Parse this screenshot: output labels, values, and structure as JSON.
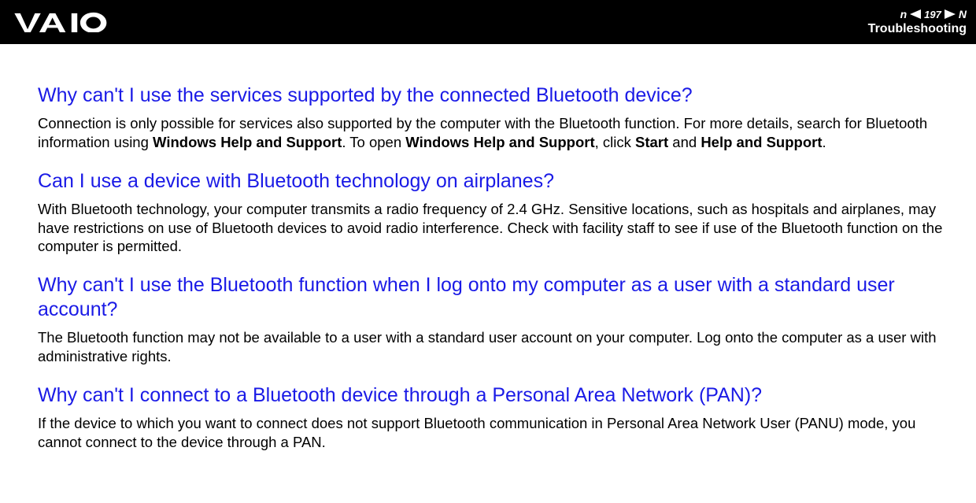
{
  "header": {
    "page_number": "197",
    "n_left": "n",
    "n_right": "N",
    "section": "Troubleshooting"
  },
  "sections": [
    {
      "question": "Why can't I use the services supported by the connected Bluetooth device?",
      "answer_parts": [
        {
          "text": "Connection is only possible for services also supported by the computer with the Bluetooth function. For more details, search for Bluetooth information using ",
          "bold": false
        },
        {
          "text": "Windows Help and Support",
          "bold": true
        },
        {
          "text": ". To open ",
          "bold": false
        },
        {
          "text": "Windows Help and Support",
          "bold": true
        },
        {
          "text": ", click ",
          "bold": false
        },
        {
          "text": "Start",
          "bold": true
        },
        {
          "text": " and ",
          "bold": false
        },
        {
          "text": "Help and Support",
          "bold": true
        },
        {
          "text": ".",
          "bold": false
        }
      ]
    },
    {
      "question": "Can I use a device with Bluetooth technology on airplanes?",
      "answer_parts": [
        {
          "text": "With Bluetooth technology, your computer transmits a radio frequency of 2.4 GHz. Sensitive locations, such as hospitals and airplanes, may have restrictions on use of Bluetooth devices to avoid radio interference. Check with facility staff to see if use of the Bluetooth function on the computer is permitted.",
          "bold": false
        }
      ]
    },
    {
      "question": "Why can't I use the Bluetooth function when I log onto my computer as a user with a standard user account?",
      "answer_parts": [
        {
          "text": "The Bluetooth function may not be available to a user with a standard user account on your computer. Log onto the computer as a user with administrative rights.",
          "bold": false
        }
      ]
    },
    {
      "question": "Why can't I connect to a Bluetooth device through a Personal Area Network (PAN)?",
      "answer_parts": [
        {
          "text": "If the device to which you want to connect does not support Bluetooth communication in Personal Area Network User (PANU) mode, you cannot connect to the device through a PAN.",
          "bold": false
        }
      ]
    }
  ]
}
